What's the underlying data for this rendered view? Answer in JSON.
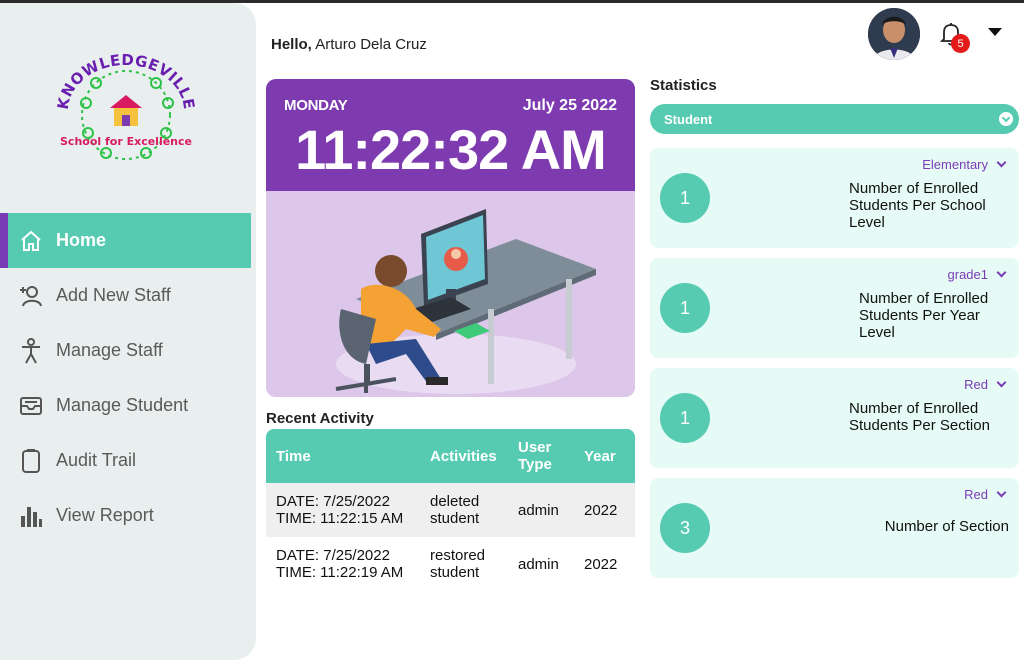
{
  "user": {
    "greeting": "Hello,",
    "name": "Arturo Dela Cruz",
    "notification_count": "5"
  },
  "logo": {
    "top_text": "KNOWLEDGEVILLE",
    "bottom_text": "School for Excellence"
  },
  "sidebar": {
    "items": [
      {
        "label": "Home",
        "icon": "home-icon",
        "active": true
      },
      {
        "label": "Add New Staff",
        "icon": "add-user-icon"
      },
      {
        "label": "Manage Staff",
        "icon": "person-icon"
      },
      {
        "label": "Manage Student",
        "icon": "inbox-icon"
      },
      {
        "label": "Audit Trail",
        "icon": "clipboard-icon"
      },
      {
        "label": "View Report",
        "icon": "bar-chart-icon"
      }
    ]
  },
  "clock": {
    "day": "MONDAY",
    "date": "July 25 2022",
    "time": "11:22:32 AM"
  },
  "recent": {
    "title": "Recent Activity",
    "columns": [
      "Time",
      "Activities",
      "User Type",
      "Year"
    ],
    "rows": [
      {
        "date": "DATE: 7/25/2022",
        "time": "TIME: 11:22:15 AM",
        "activity": "deleted student",
        "user_type": "admin",
        "year": "2022"
      },
      {
        "date": "DATE: 7/25/2022",
        "time": "TIME: 11:22:19 AM",
        "activity": "restored student",
        "user_type": "admin",
        "year": "2022"
      }
    ]
  },
  "statistics": {
    "title": "Statistics",
    "selected": "Student",
    "cards": [
      {
        "value": "1",
        "filter": "Elementary",
        "label": "Number of Enrolled Students Per School Level"
      },
      {
        "value": "1",
        "filter": "grade1",
        "label": "Number of Enrolled Students Per Year Level"
      },
      {
        "value": "1",
        "filter": "Red",
        "label": "Number of Enrolled Students Per Section"
      },
      {
        "value": "3",
        "filter": "Red",
        "label": "Number of Section"
      }
    ]
  },
  "colors": {
    "accent": "#57cbb2",
    "purple": "#7e3bb0",
    "sidebar_bg": "#e8efee",
    "card_bg": "#e6fbf6",
    "badge": "#e31b1b"
  }
}
